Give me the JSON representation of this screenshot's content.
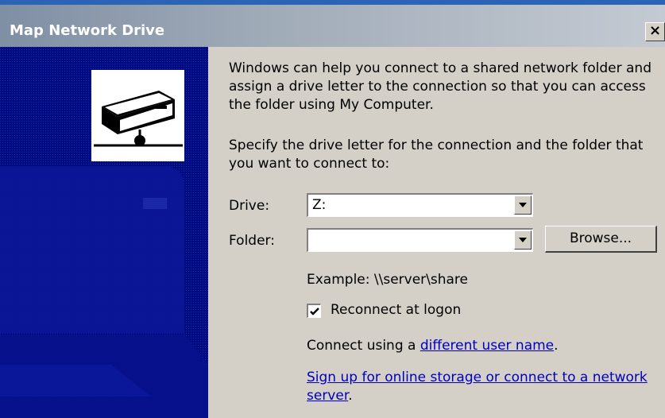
{
  "window": {
    "title": "Map Network Drive",
    "close_glyph": "×"
  },
  "intro_text": "Windows can help you connect to a shared network folder and assign a drive letter to the connection so that you can access the folder using My Computer.",
  "instruction_text": "Specify the drive letter for the connection and the folder that you want to connect to:",
  "drive": {
    "label": "Drive:",
    "value": "Z:"
  },
  "folder": {
    "label": "Folder:",
    "value": ""
  },
  "browse_button": "Browse...",
  "example_text": "Example: \\\\server\\share",
  "reconnect": {
    "label": "Reconnect at logon",
    "checked": true
  },
  "connect_using": {
    "prefix": "Connect using a ",
    "link": "different user name",
    "suffix": "."
  },
  "signup": {
    "link": "Sign up for online storage or connect to a network server",
    "suffix": "."
  },
  "icons": [
    "network-drive-icon",
    "close-icon",
    "dropdown-arrow-icon",
    "checkmark-icon"
  ],
  "colors": {
    "sidebar": "#000c80",
    "dialog_bg": "#d4d0c8",
    "link": "#0000c0",
    "title_bar": "#a0abb8"
  }
}
